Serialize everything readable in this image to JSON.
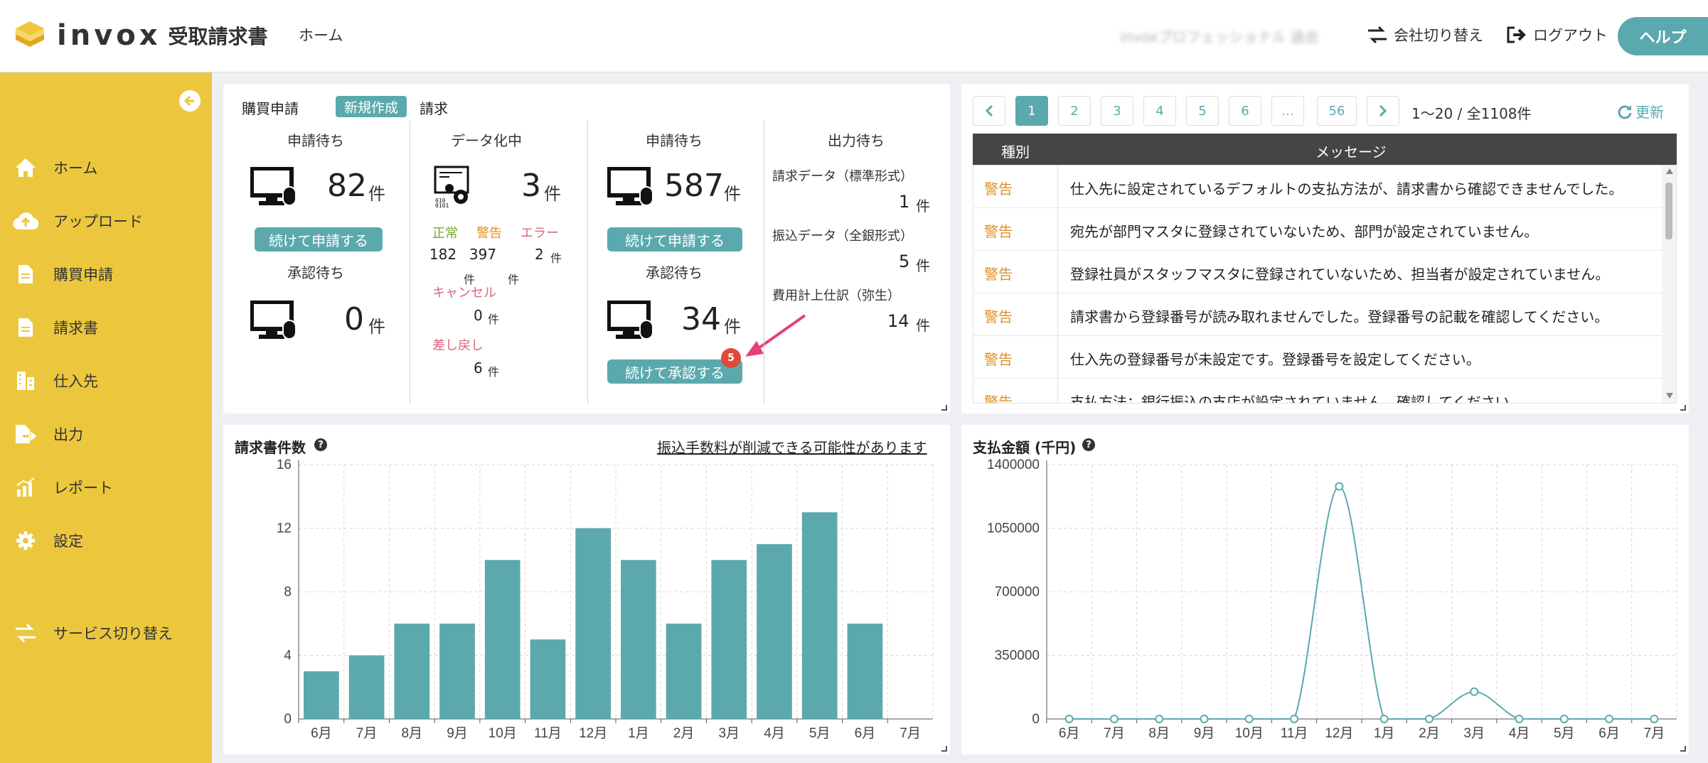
{
  "header": {
    "product": "受取請求書",
    "brand": "invox",
    "nav_home": "ホーム",
    "company": "invoxプロフェッショナル 過去",
    "switch_company": "会社切り替え",
    "logout": "ログアウト",
    "help": "ヘルプ"
  },
  "sidebar": {
    "items": [
      {
        "label": "ホーム",
        "icon": "home-icon"
      },
      {
        "label": "アップロード",
        "icon": "cloud-upload-icon"
      },
      {
        "label": "購買申請",
        "icon": "document-icon"
      },
      {
        "label": "請求書",
        "icon": "document-icon"
      },
      {
        "label": "仕入先",
        "icon": "building-icon"
      },
      {
        "label": "出力",
        "icon": "export-icon"
      },
      {
        "label": "レポート",
        "icon": "report-icon"
      },
      {
        "label": "設定",
        "icon": "gear-icon"
      },
      {
        "label": "サービス切り替え",
        "icon": "switch-icon"
      }
    ]
  },
  "summary": {
    "purchase_title": "購買申請",
    "new_button": "新規作成",
    "invoice_title": "請求",
    "purchase": {
      "apply_header": "申請待ち",
      "apply_count": "82",
      "unit": "件",
      "apply_button": "続けて申請する",
      "approve_header": "承認待ち",
      "approve_count": "0"
    },
    "digitizing": {
      "header": "データ化中",
      "count": "3",
      "normal_label": "正常",
      "warning_label": "警告",
      "error_label": "エラー",
      "normal": "182",
      "warning": "397",
      "error": "2",
      "cancel_label": "キャンセル",
      "cancel": "0",
      "return_label": "差し戻し",
      "return": "6"
    },
    "invoice": {
      "apply_header": "申請待ち",
      "apply_count": "587",
      "apply_button": "続けて申請する",
      "approve_header": "承認待ち",
      "approve_count": "34",
      "approve_button": "続けて承認する",
      "badge": "5"
    },
    "output": {
      "header": "出力待ち",
      "items": [
        {
          "label": "請求データ（標準形式）",
          "count": "1"
        },
        {
          "label": "振込データ（全銀形式）",
          "count": "5"
        },
        {
          "label": "費用計上仕訳（弥生）",
          "count": "14"
        }
      ]
    }
  },
  "messages": {
    "pages": [
      "1",
      "2",
      "3",
      "4",
      "5",
      "6",
      "…",
      "56"
    ],
    "current_page": "1",
    "range": "1〜20 / 全1108件",
    "refresh": "更新",
    "col_type": "種別",
    "col_message": "メッセージ",
    "rows": [
      {
        "type": "警告",
        "message": "仕入先に設定されているデフォルトの支払方法が、請求書から確認できませんでした。"
      },
      {
        "type": "警告",
        "message": "宛先が部門マスタに登録されていないため、部門が設定されていません。"
      },
      {
        "type": "警告",
        "message": "登録社員がスタッフマスタに登録されていないため、担当者が設定されていません。"
      },
      {
        "type": "警告",
        "message": "請求書から登録番号が読み取れませんでした。登録番号の記載を確認してください。"
      },
      {
        "type": "警告",
        "message": "仕入先の登録番号が未設定です。登録番号を設定してください。"
      },
      {
        "type": "警告",
        "message": "支払方法：銀行振込の支店が設定されていません。確認してください。"
      }
    ]
  },
  "count_panel": {
    "title": "請求書件数",
    "link": "振込手数料が削減できる可能性があります"
  },
  "amount_panel": {
    "title": "支払金額 (千円)"
  },
  "colors": {
    "accent": "#5ba9ad",
    "sidebar": "#ecc73d",
    "warning": "#e0901e",
    "error": "#d9667a"
  },
  "chart_data": [
    {
      "type": "bar",
      "title": "請求書件数",
      "categories": [
        "6月",
        "7月",
        "8月",
        "9月",
        "10月",
        "11月",
        "12月",
        "1月",
        "2月",
        "3月",
        "4月",
        "5月",
        "6月",
        "7月"
      ],
      "values": [
        3,
        4,
        6,
        6,
        10,
        5,
        12,
        10,
        6,
        10,
        11,
        13,
        6,
        0
      ],
      "ylim": [
        0,
        16
      ],
      "yticks": [
        "0",
        "4",
        "8",
        "12",
        "16"
      ],
      "grid": true
    },
    {
      "type": "line",
      "title": "支払金額 (千円)",
      "categories": [
        "6月",
        "7月",
        "8月",
        "9月",
        "10月",
        "11月",
        "12月",
        "1月",
        "2月",
        "3月",
        "4月",
        "5月",
        "6月",
        "7月"
      ],
      "values": [
        0,
        0,
        0,
        0,
        0,
        0,
        1280000,
        0,
        0,
        150000,
        0,
        0,
        0,
        0
      ],
      "ylim": [
        0,
        1400000
      ],
      "yticks": [
        "0",
        "350000",
        "700000",
        "1050000",
        "1400000"
      ],
      "grid": true
    }
  ]
}
